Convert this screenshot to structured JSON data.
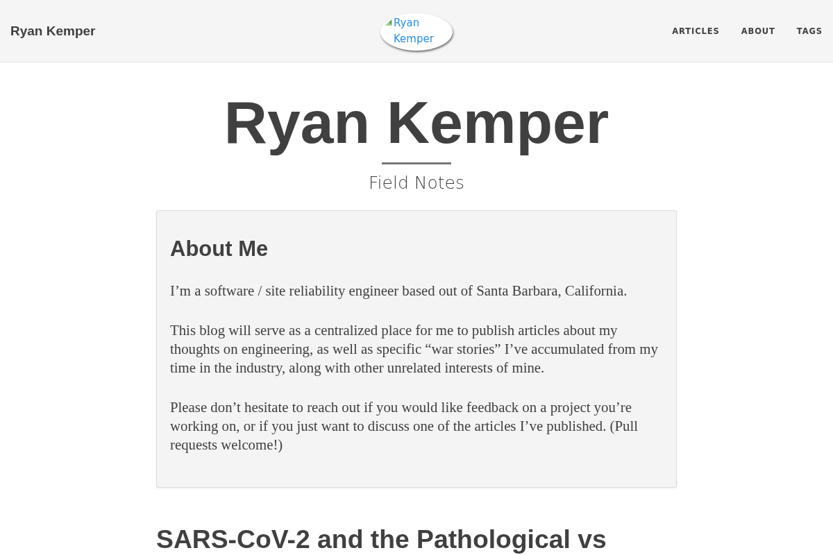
{
  "navbar": {
    "brand": "Ryan Kemper",
    "avatar": {
      "alt": "Ryan Kemper"
    },
    "links": [
      {
        "label": "ARTICLES"
      },
      {
        "label": "ABOUT"
      },
      {
        "label": "TAGS"
      }
    ]
  },
  "header": {
    "title": "Ryan Kemper",
    "subtitle": "Field Notes"
  },
  "about": {
    "heading": "About Me",
    "paragraphs": [
      "I’m a software / site reliability engineer based out of Santa Barbara, California.",
      "This blog will serve as a centralized place for me to publish articles about my thoughts on engineering, as well as specific “war stories” I’ve accumulated from my time in the industry, along with other unrelated interests of mine.",
      "Please don’t hesitate to reach out if you would like feedback on a project you’re working on, or if you just want to discuss one of the articles I’ve published. (Pull requests welcome!)"
    ]
  },
  "posts": [
    {
      "title": "SARS-CoV-2 and the Pathological vs"
    }
  ]
}
